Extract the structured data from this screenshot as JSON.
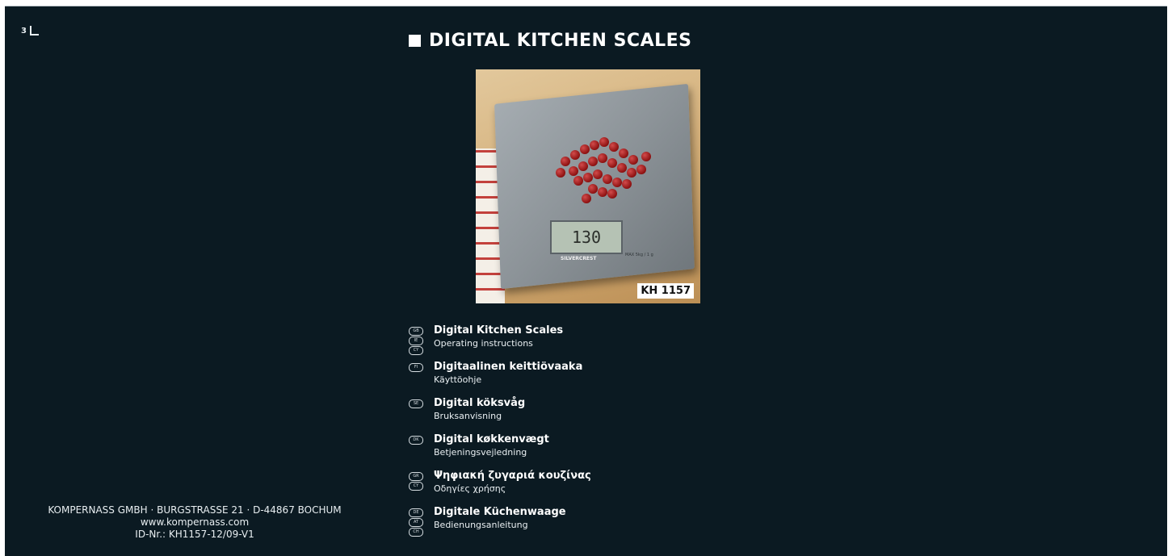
{
  "page_number": "3",
  "title": "DIGITAL KITCHEN SCALES",
  "photo": {
    "display_value": "130",
    "brand": "SILVERCREST",
    "max_label": "MAX 5kg / 1 g",
    "model_label": "KH 1157"
  },
  "languages": [
    {
      "codes": [
        "GB",
        "IE",
        "CY"
      ],
      "name": "Digital Kitchen Scales",
      "subtitle": "Operating instructions"
    },
    {
      "codes": [
        "FI"
      ],
      "name": "Digitaalinen keittiövaaka",
      "subtitle": "Käyttöohje"
    },
    {
      "codes": [
        "SE"
      ],
      "name": "Digital köksvåg",
      "subtitle": "Bruksanvisning"
    },
    {
      "codes": [
        "DK"
      ],
      "name": "Digital køkkenvægt",
      "subtitle": "Betjeningsvejledning"
    },
    {
      "codes": [
        "GR",
        "CY"
      ],
      "name": "Ψηφιακή ζυγαριά κουζίνας",
      "subtitle": "Οδηγίες χρήσης"
    },
    {
      "codes": [
        "DE",
        "AT",
        "CH"
      ],
      "name": "Digitale Küchenwaage",
      "subtitle": "Bedienungsanleitung"
    }
  ],
  "address": {
    "line1": "KOMPERNASS GMBH · BURGSTRASSE 21 · D-44867 BOCHUM",
    "line2": "www.kompernass.com",
    "line3": "ID-Nr.: KH1157-12/09-V1"
  },
  "colors": {
    "background": "#0b1a22",
    "text": "#ffffff"
  }
}
